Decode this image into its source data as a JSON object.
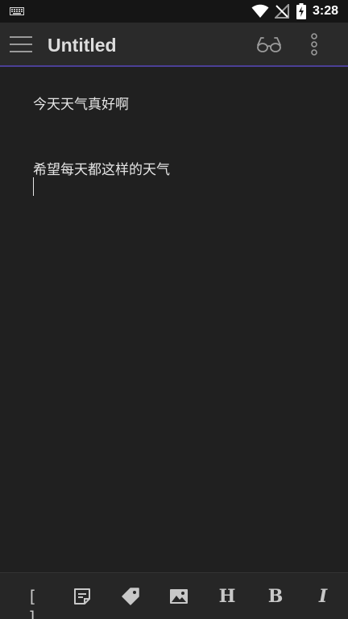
{
  "status_bar": {
    "time": "3:28",
    "icons": [
      "keyboard-icon",
      "wifi-icon",
      "no-signal-icon",
      "battery-charging-icon"
    ]
  },
  "app_bar": {
    "title": "Untitled",
    "menu_icon": "hamburger-menu-icon",
    "preview_icon": "glasses-icon",
    "more_icon": "more-vertical-icon"
  },
  "editor": {
    "lines": [
      "今天天气真好啊",
      "",
      "希望每天都这样的天气",
      ""
    ]
  },
  "toolbar": {
    "items": [
      {
        "name": "brackets",
        "label": "[ ]",
        "icon": "brackets-icon"
      },
      {
        "name": "snippet",
        "label": "",
        "icon": "sticky-note-icon"
      },
      {
        "name": "tag",
        "label": "",
        "icon": "tag-icon"
      },
      {
        "name": "image",
        "label": "",
        "icon": "image-icon"
      },
      {
        "name": "heading",
        "label": "H",
        "icon": "heading-icon"
      },
      {
        "name": "bold",
        "label": "B",
        "icon": "bold-icon"
      },
      {
        "name": "italic",
        "label": "I",
        "icon": "italic-icon"
      }
    ]
  },
  "colors": {
    "background": "#202020",
    "app_bar": "#2a2a2a",
    "status_bar": "#151515",
    "accent": "#4b3f96",
    "text": "#e6e6e6",
    "icon": "#c8c8c8"
  }
}
